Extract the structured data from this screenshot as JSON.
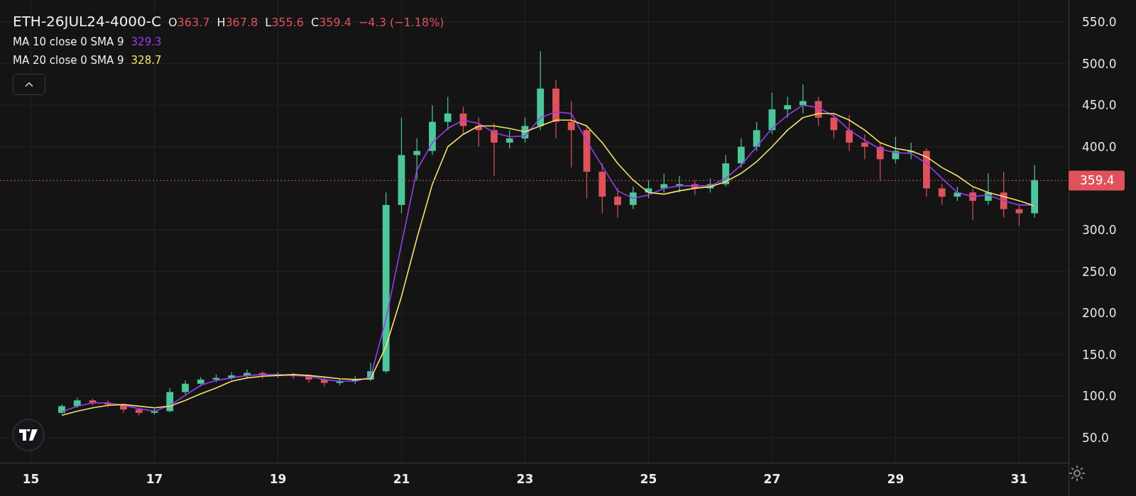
{
  "legend": {
    "symbol": "ETH-26JUL24-4000-C",
    "ohlc": [
      {
        "label": "O",
        "value": "363.7"
      },
      {
        "label": "H",
        "value": "367.8"
      },
      {
        "label": "L",
        "value": "355.6"
      },
      {
        "label": "C",
        "value": "359.4"
      }
    ],
    "change": "−4.3 (−1.18%)",
    "indicators": [
      {
        "value": "329.3",
        "color": "#9b3bf2"
      },
      {
        "value": "328.7",
        "color": "#f2e46b"
      }
    ]
  },
  "last_price": "359.4",
  "chart": {
    "chart_data": {
      "type": "candlestick",
      "grid": true,
      "xlim": [
        14.5,
        31.8
      ],
      "ylim": [
        20.1,
        576.5
      ],
      "series": [
        {
          "name": "MA 10 close 0 SMA 9",
          "type": "line",
          "color": "#9b3bf2",
          "values": [
            81,
            88,
            92,
            92,
            89,
            85,
            82,
            89,
            101,
            113,
            119,
            122,
            125,
            126,
            126,
            125,
            124,
            120,
            118,
            118,
            123,
            193,
            283,
            372,
            405,
            422,
            432,
            428,
            417,
            412,
            413,
            435,
            442,
            440,
            407,
            377,
            347,
            338,
            342,
            350,
            353,
            353,
            353,
            362,
            378,
            400,
            422,
            438,
            450,
            447,
            437,
            420,
            408,
            397,
            393,
            392,
            380,
            362,
            345,
            340,
            342,
            335,
            330,
            330
          ]
        },
        {
          "name": "MA 20 close 0 SMA 9",
          "type": "line",
          "color": "#f2e46b",
          "values": [
            77,
            82,
            86,
            89,
            90,
            88,
            86,
            88,
            95,
            103,
            110,
            118,
            122,
            124,
            125,
            126,
            125,
            123,
            121,
            120,
            121,
            160,
            220,
            290,
            355,
            400,
            415,
            425,
            425,
            422,
            418,
            425,
            432,
            432,
            425,
            405,
            380,
            360,
            345,
            343,
            347,
            350,
            352,
            358,
            368,
            382,
            400,
            420,
            435,
            440,
            440,
            432,
            420,
            405,
            398,
            395,
            388,
            375,
            365,
            352,
            345,
            340,
            335,
            329
          ]
        }
      ],
      "ref_lines": [
        {
          "axis": "y",
          "value": 359.4,
          "color": "#e0515c"
        }
      ],
      "x": [
        15.5,
        15.75,
        16,
        16.25,
        16.5,
        16.75,
        17,
        17.25,
        17.5,
        17.75,
        18,
        18.25,
        18.5,
        18.75,
        19,
        19.25,
        19.5,
        19.75,
        20,
        20.25,
        20.5,
        20.75,
        21,
        21.25,
        21.5,
        21.75,
        22,
        22.25,
        22.5,
        22.75,
        23,
        23.25,
        23.5,
        23.75,
        24,
        24.25,
        24.5,
        24.75,
        25,
        25.25,
        25.5,
        25.75,
        26,
        26.25,
        26.5,
        26.75,
        27,
        27.25,
        27.5,
        27.75,
        28,
        28.25,
        28.5,
        28.75,
        29,
        29.25,
        29.5,
        29.75,
        30,
        30.25,
        30.5,
        30.75,
        31,
        31.25
      ],
      "ohlc": [
        [
          80,
          90,
          79,
          88
        ],
        [
          88,
          98,
          86,
          95
        ],
        [
          95,
          97,
          89,
          92
        ],
        [
          92,
          95,
          87,
          90
        ],
        [
          90,
          91,
          80,
          84
        ],
        [
          84,
          86,
          77,
          80
        ],
        [
          80,
          85,
          78,
          82
        ],
        [
          82,
          110,
          81,
          105
        ],
        [
          105,
          119,
          102,
          115
        ],
        [
          115,
          123,
          112,
          120
        ],
        [
          120,
          126,
          117,
          122
        ],
        [
          122,
          129,
          120,
          125
        ],
        [
          125,
          132,
          122,
          128
        ],
        [
          128,
          130,
          121,
          125
        ],
        [
          125,
          129,
          122,
          126
        ],
        [
          126,
          128,
          121,
          124
        ],
        [
          124,
          126,
          116,
          120
        ],
        [
          120,
          122,
          112,
          116
        ],
        [
          116,
          121,
          113,
          118
        ],
        [
          118,
          124,
          115,
          120
        ],
        [
          120,
          140,
          118,
          130
        ],
        [
          130,
          345,
          128,
          330
        ],
        [
          330,
          435,
          320,
          390
        ],
        [
          390,
          410,
          360,
          395
        ],
        [
          395,
          450,
          390,
          430
        ],
        [
          430,
          460,
          420,
          440
        ],
        [
          440,
          448,
          415,
          425
        ],
        [
          425,
          435,
          400,
          420
        ],
        [
          420,
          428,
          365,
          405
        ],
        [
          405,
          420,
          398,
          410
        ],
        [
          410,
          435,
          405,
          425
        ],
        [
          425,
          515,
          420,
          470
        ],
        [
          470,
          480,
          410,
          430
        ],
        [
          430,
          455,
          375,
          420
        ],
        [
          420,
          425,
          338,
          370
        ],
        [
          370,
          380,
          320,
          340
        ],
        [
          340,
          350,
          315,
          330
        ],
        [
          330,
          352,
          325,
          345
        ],
        [
          345,
          360,
          338,
          350
        ],
        [
          350,
          368,
          345,
          355
        ],
        [
          355,
          365,
          345,
          355
        ],
        [
          355,
          360,
          342,
          350
        ],
        [
          350,
          362,
          345,
          355
        ],
        [
          355,
          390,
          352,
          380
        ],
        [
          380,
          410,
          375,
          400
        ],
        [
          400,
          430,
          395,
          420
        ],
        [
          420,
          465,
          415,
          445
        ],
        [
          445,
          460,
          435,
          450
        ],
        [
          450,
          475,
          440,
          455
        ],
        [
          455,
          460,
          425,
          435
        ],
        [
          435,
          440,
          410,
          420
        ],
        [
          420,
          438,
          395,
          405
        ],
        [
          405,
          415,
          385,
          400
        ],
        [
          400,
          405,
          360,
          385
        ],
        [
          385,
          412,
          380,
          395
        ],
        [
          395,
          405,
          385,
          395
        ],
        [
          395,
          398,
          340,
          350
        ],
        [
          350,
          355,
          330,
          340
        ],
        [
          340,
          352,
          335,
          345
        ],
        [
          345,
          350,
          312,
          335
        ],
        [
          335,
          368,
          330,
          345
        ],
        [
          345,
          370,
          315,
          325
        ],
        [
          325,
          330,
          305,
          320
        ],
        [
          320,
          378,
          315,
          360
        ]
      ],
      "xticks": [
        {
          "value": 15,
          "label": "15"
        },
        {
          "value": 17,
          "label": "17"
        },
        {
          "value": 19,
          "label": "19"
        },
        {
          "value": 21,
          "label": "21"
        },
        {
          "value": 23,
          "label": "23"
        },
        {
          "value": 25,
          "label": "25"
        },
        {
          "value": 27,
          "label": "27"
        },
        {
          "value": 29,
          "label": "29"
        },
        {
          "value": 31,
          "label": "31"
        }
      ],
      "yticks": [
        {
          "value": 50,
          "label": "50.0"
        },
        {
          "value": 100,
          "label": "100.0"
        },
        {
          "value": 150,
          "label": "150.0"
        },
        {
          "value": 200,
          "label": "200.0"
        },
        {
          "value": 250,
          "label": "250.0"
        },
        {
          "value": 300,
          "label": "300.0"
        },
        {
          "value": 400,
          "label": "400.0"
        },
        {
          "value": 450,
          "label": "450.0"
        },
        {
          "value": 500,
          "label": "500.0"
        },
        {
          "value": 550,
          "label": "550.0"
        }
      ]
    }
  }
}
